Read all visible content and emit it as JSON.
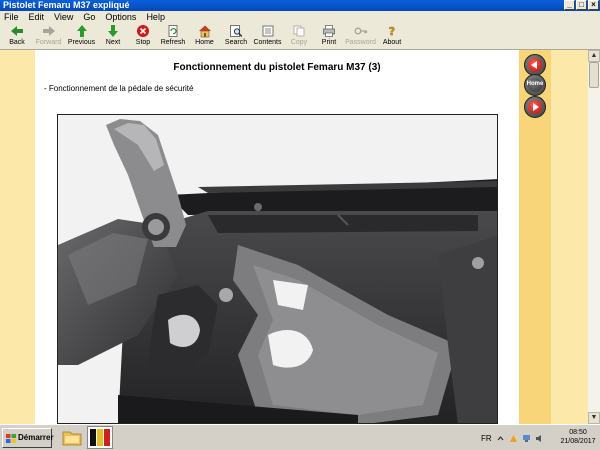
{
  "window": {
    "title": "Pistolet Femaru M37 expliqué",
    "controls": [
      "_",
      "□",
      "×"
    ]
  },
  "menu": [
    "File",
    "Edit",
    "View",
    "Go",
    "Options",
    "Help"
  ],
  "toolbar": [
    {
      "label": "Back",
      "icon": "back-arrow-icon",
      "enabled": true
    },
    {
      "label": "Forward",
      "icon": "forward-arrow-icon",
      "enabled": false
    },
    {
      "label": "Previous",
      "icon": "up-arrow-icon",
      "enabled": true
    },
    {
      "label": "Next",
      "icon": "down-arrow-icon",
      "enabled": true
    },
    {
      "label": "Stop",
      "icon": "stop-icon",
      "enabled": true
    },
    {
      "label": "Refresh",
      "icon": "refresh-icon",
      "enabled": true
    },
    {
      "label": "Home",
      "icon": "home-icon",
      "enabled": true
    },
    {
      "label": "Search",
      "icon": "search-icon",
      "enabled": true
    },
    {
      "label": "Contents",
      "icon": "contents-icon",
      "enabled": true
    },
    {
      "label": "Copy",
      "icon": "copy-icon",
      "enabled": false
    },
    {
      "label": "Print",
      "icon": "print-icon",
      "enabled": true
    },
    {
      "label": "Password",
      "icon": "key-icon",
      "enabled": false
    },
    {
      "label": "About",
      "icon": "about-icon",
      "enabled": true
    }
  ],
  "page": {
    "title": "Fonctionnement du pistolet Femaru M37 (3)",
    "subtitle": "- Fonctionnement de la pédale de sécurité"
  },
  "nav": {
    "home_label": "Home"
  },
  "taskbar": {
    "start_label": "Démarrer",
    "language": "FR",
    "time": "08:50",
    "date": "21/08/2017"
  },
  "colors": {
    "titlebar": "#0548b8",
    "page_margin": "#fce8a8",
    "nav_strip": "#f9d57a",
    "nav_button": "#c01818"
  }
}
